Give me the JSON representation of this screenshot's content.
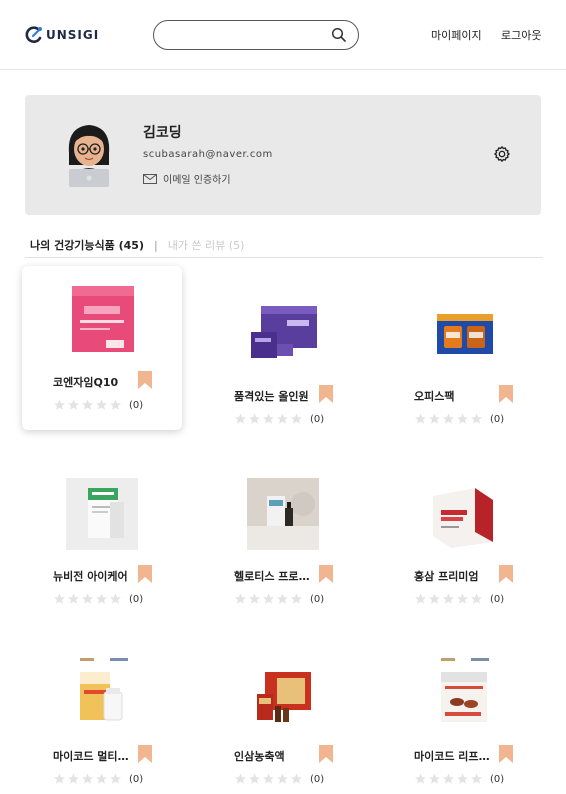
{
  "header": {
    "logo_text": "UNSIGI",
    "search_value": "",
    "search_placeholder": "",
    "nav_mypage": "마이페이지",
    "nav_logout": "로그아웃"
  },
  "profile": {
    "name": "김코딩",
    "email": "scubasarah@naver.com",
    "verify_label": "이메일 인증하기"
  },
  "tabs": {
    "active": "나의 건강기능식품 (45)",
    "separator": "|",
    "inactive": "내가 쓴 리뷰 (5)"
  },
  "colors": {
    "bookmark": "#f1b58f",
    "star_empty": "#e3e3e3",
    "profile_bg": "#e9e9e9"
  },
  "products": [
    {
      "name": "코엔자임Q10",
      "count": "(0)",
      "rating": 0
    },
    {
      "name": "품격있는 올인원",
      "count": "(0)",
      "rating": 0
    },
    {
      "name": "오피스팩",
      "count": "(0)",
      "rating": 0
    },
    {
      "name": "뉴비전 아이케어",
      "count": "(0)",
      "rating": 0
    },
    {
      "name": "헬로티스 프로폴리스",
      "count": "(0)",
      "rating": 0
    },
    {
      "name": "홍삼 프리미엄",
      "count": "(0)",
      "rating": 0
    },
    {
      "name": "마이코드 멀티비타민",
      "count": "(0)",
      "rating": 0
    },
    {
      "name": "인삼농축액",
      "count": "(0)",
      "rating": 0
    },
    {
      "name": "마이코드 리프레시",
      "count": "(0)",
      "rating": 0
    }
  ]
}
